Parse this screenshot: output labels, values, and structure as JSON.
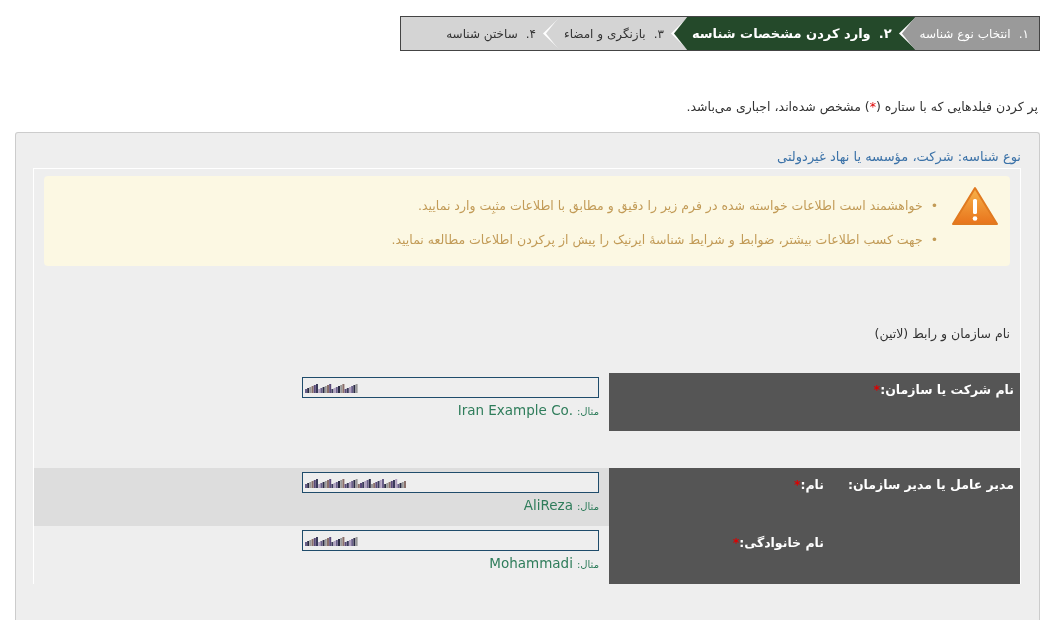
{
  "steps": [
    {
      "number": "۱.",
      "label": "انتخاب نوع شناسه",
      "selected": false,
      "completed": true
    },
    {
      "number": "۲.",
      "label": "وارد کردن مشخصات شناسه",
      "selected": true,
      "completed": false
    },
    {
      "number": "۳.",
      "label": "بازنگری و امضاء",
      "selected": false,
      "completed": false
    },
    {
      "number": "۴.",
      "label": "ساختن شناسه",
      "selected": false,
      "completed": false
    }
  ],
  "notice": {
    "before": "پر کردن فیلدهایی که با ستاره (",
    "mark": "*",
    "after": ") مشخص شده‌اند، اجباری می‌باشد."
  },
  "panel": {
    "title": "نوع شناسه: شرکت، مؤسسه یا نهاد غیردولتی",
    "alert": {
      "items": [
        {
          "bullet": "•",
          "text": "خواهشمند است اطلاعات خواسته شده در فرم زیر را دقیق و مطابق با اطلاعات مثبِت وارد نمایید."
        },
        {
          "bullet": "•",
          "text": "جهت کسب اطلاعات بیشتر، ضوابط و شرایط شناسهٔ ایرنیک را پیش از پرکردن اطلاعات مطالعه نمایید."
        }
      ]
    },
    "section_title": "نام سازمان و رابط (لاتین)",
    "field": {
      "label": "نام شرکت یا سازمان:",
      "required_mark": "*",
      "example_label": "مثال:",
      "example": "Iran Example Co.",
      "value_redacted": true
    },
    "group": {
      "label": "مدیر عامل یا مدیر سازمان:",
      "fields": [
        {
          "label": "نام:",
          "required_mark": "*",
          "example_label": "مثال:",
          "example": "AliReza",
          "value_redacted": true
        },
        {
          "label": "نام خانوادگی:",
          "required_mark": "*",
          "example_label": "مثال:",
          "example": "Mohammadi",
          "value_redacted": true
        }
      ]
    }
  }
}
